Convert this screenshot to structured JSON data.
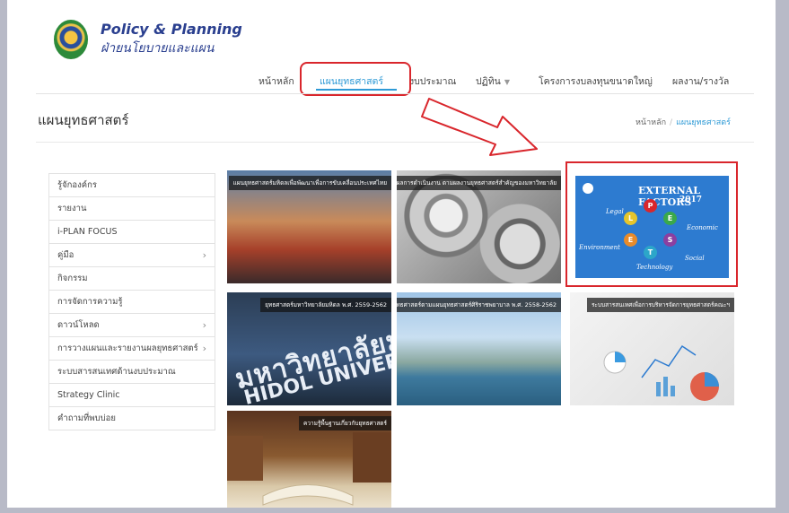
{
  "brand": {
    "title": "Policy & Planning",
    "subtitle": "ฝ่ายนโยบายและแผน"
  },
  "nav": [
    {
      "label": "หน้าหลัก"
    },
    {
      "label": "แผนยุทธศาสตร์",
      "active": true
    },
    {
      "label": "งบประมาณ"
    },
    {
      "label": "ปฏิทิน",
      "has_dropdown": true
    },
    {
      "label": "โครงการงบลงทุนขนาดใหญ่"
    },
    {
      "label": "ผลงาน/รางวัล"
    }
  ],
  "page": {
    "title": "แผนยุทธศาสตร์"
  },
  "breadcrumb": {
    "home": "หน้าหลัก",
    "separator": "/",
    "current": "แผนยุทธศาสตร์"
  },
  "sidebar": [
    {
      "label": "รู้จักองค์กร"
    },
    {
      "label": "รายงาน"
    },
    {
      "label": "i-PLAN FOCUS"
    },
    {
      "label": "คู่มือ",
      "chevron": "›"
    },
    {
      "label": "กิจกรรม"
    },
    {
      "label": "การจัดการความรู้"
    },
    {
      "label": "ดาวน์โหลด",
      "chevron": "›"
    },
    {
      "label": "การวางแผนและรายงานผลยุทธศาสตร์",
      "chevron": "›"
    },
    {
      "label": "ระบบสารสนเทศด้านงบประมาณ"
    },
    {
      "label": "Strategy Clinic"
    },
    {
      "label": "คำถามที่พบบ่อย"
    }
  ],
  "tiles": [
    {
      "caption": "แผนยุทธศาสตร์มหิดลเพื่อพัฒนาเพื่อการขับเคลื่อนประเทศไทย",
      "icon": "city-skyline-image"
    },
    {
      "caption": "ผลการดำเนินงาน ตามผลงานยุทธศาสตร์สำคัญของมหาวิทยาลัย",
      "icon": "gears-image"
    },
    {
      "caption": "",
      "icon": "external-factors-image",
      "external": {
        "title": "EXTERNAL FACTORS",
        "year": "2017",
        "letters": [
          "P",
          "E",
          "S",
          "T",
          "E",
          "L"
        ],
        "words": [
          "Legal",
          "Economic",
          "Environment",
          "Social",
          "Technology"
        ]
      }
    },
    {
      "caption": "ยุทธศาสตร์มหาวิทยาลัยมหิดล พ.ศ. 2559-2562",
      "icon": "university-sign-image",
      "sign": {
        "thai": "มหาวิทยาลัยมหิดล",
        "latin": "HIDOL UNIVERSITY"
      }
    },
    {
      "caption": "ยุทธศาสตร์ตามแผนยุทธศาสตร์ศิริราชพยาบาล พ.ศ. 2558-2562",
      "icon": "hospital-river-image"
    },
    {
      "caption": "ระบบสารสนเทศเพื่อการบริหารจัดการยุทธศาสตร์คณะฯ",
      "icon": "charts-desk-image"
    },
    {
      "caption": "ความรู้พื้นฐานเกี่ยวกับยุทธศาสตร์",
      "icon": "books-image"
    }
  ],
  "colors": {
    "accent": "#2e9ad6",
    "highlight": "#d9262c",
    "brand": "#2a3f8f"
  }
}
